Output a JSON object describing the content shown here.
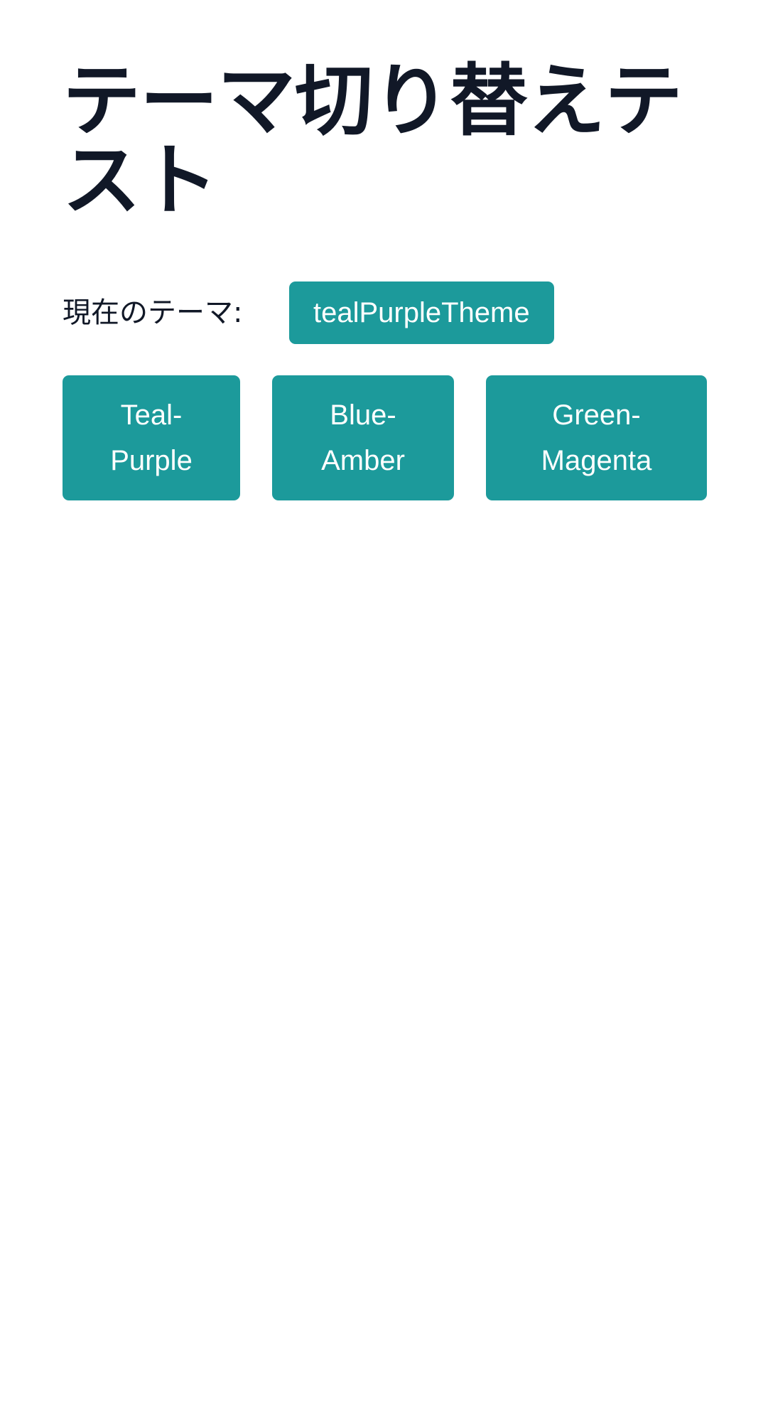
{
  "page": {
    "title": "テーマ切り替えテスト"
  },
  "current_theme": {
    "label": "現在のテーマ:",
    "value": "tealPurpleTheme"
  },
  "theme_buttons": [
    {
      "label": "Teal-\nPurple"
    },
    {
      "label": "Blue-\nAmber"
    },
    {
      "label": "Green-\nMagenta"
    }
  ],
  "colors": {
    "accent": "#1c9a9b",
    "text": "#111827",
    "button_text": "#ffffff",
    "background": "#ffffff"
  }
}
